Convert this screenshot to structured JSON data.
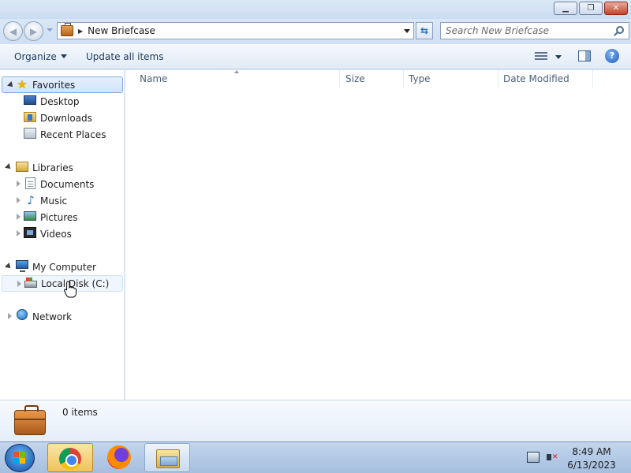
{
  "window": {
    "minimize_glyph": "▁",
    "maximize_glyph": "❐",
    "close_glyph": "✕"
  },
  "address": {
    "crumb": "New Briefcase",
    "back_glyph": "◀",
    "forward_glyph": "▶",
    "refresh_glyph": "⇆"
  },
  "search": {
    "placeholder": "Search New Briefcase"
  },
  "toolbar": {
    "organize_label": "Organize",
    "update_label": "Update all items",
    "help_glyph": "?"
  },
  "nav": {
    "favorites": "Favorites",
    "desktop": "Desktop",
    "downloads": "Downloads",
    "recent_places": "Recent Places",
    "libraries": "Libraries",
    "documents": "Documents",
    "music": "Music",
    "pictures": "Pictures",
    "videos": "Videos",
    "my_computer": "My Computer",
    "local_disk": "Local Disk (C:)",
    "network": "Network"
  },
  "columns": {
    "name": "Name",
    "size": "Size",
    "type": "Type",
    "date_modified": "Date Modified"
  },
  "details": {
    "item_count": "0 items"
  },
  "taskbar": {
    "time": "8:49 AM",
    "date": "6/13/2023"
  },
  "icons": {
    "favorites": "star-icon",
    "music": "music-note-icon",
    "music_glyph": "♪",
    "star_glyph": "★"
  },
  "colors": {
    "accent": "#84acdd",
    "taskbar": "#a6bfdf",
    "active_taskbar_button": "#f0c25a"
  }
}
